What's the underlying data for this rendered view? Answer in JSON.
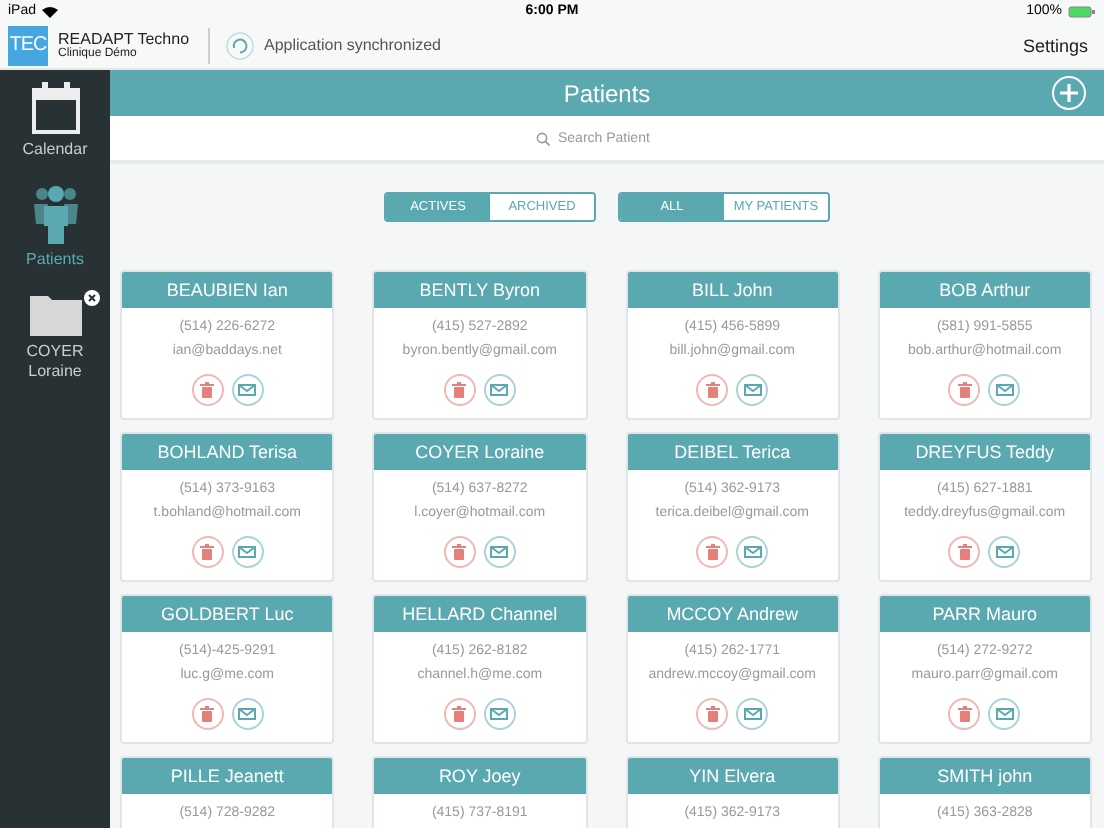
{
  "status_bar": {
    "device": "iPad",
    "time": "6:00 PM",
    "battery": "100%"
  },
  "header": {
    "logo": "TEC",
    "app_name": "READAPT Techno",
    "clinic": "Clinique Démo",
    "sync_status": "Application synchronized",
    "settings": "Settings"
  },
  "sidebar": {
    "items": [
      {
        "kind": "calendar",
        "label": "Calendar",
        "selected": false
      },
      {
        "kind": "patients",
        "label": "Patients",
        "selected": true
      },
      {
        "kind": "folder",
        "label": "COYER Loraine",
        "selected": false
      }
    ]
  },
  "title": "Patients",
  "search": {
    "placeholder": "Search Patient"
  },
  "filters": [
    [
      {
        "label": "ACTIVES",
        "selected": true
      },
      {
        "label": "ARCHIVED",
        "selected": false
      }
    ],
    [
      {
        "label": "ALL",
        "selected": true
      },
      {
        "label": "MY PATIENTS",
        "selected": false
      }
    ]
  ],
  "patients": [
    {
      "name": "BEAUBIEN Ian",
      "phone": "(514) 226-6272",
      "email": "ian@baddays.net"
    },
    {
      "name": "BENTLY Byron",
      "phone": "(415) 527-2892",
      "email": "byron.bently@gmail.com"
    },
    {
      "name": "BILL John",
      "phone": "(415) 456-5899",
      "email": "bill.john@gmail.com"
    },
    {
      "name": "BOB Arthur",
      "phone": "(581) 991-5855",
      "email": "bob.arthur@hotmail.com"
    },
    {
      "name": "BOHLAND Terisa",
      "phone": "(514) 373-9163",
      "email": "t.bohland@hotmail.com"
    },
    {
      "name": "COYER Loraine",
      "phone": "(514) 637-8272",
      "email": "l.coyer@hotmail.com"
    },
    {
      "name": "DEIBEL Terica",
      "phone": "(514) 362-9173",
      "email": "terica.deibel@gmail.com"
    },
    {
      "name": "DREYFUS Teddy",
      "phone": "(415) 627-1881",
      "email": "teddy.dreyfus@gmail.com"
    },
    {
      "name": "GOLDBERT Luc",
      "phone": "(514)-425-9291",
      "email": "luc.g@me.com"
    },
    {
      "name": "HELLARD Channel",
      "phone": "(415) 262-8182",
      "email": "channel.h@me.com"
    },
    {
      "name": "MCCOY Andrew",
      "phone": "(415) 262-1771",
      "email": "andrew.mccoy@gmail.com"
    },
    {
      "name": "PARR Mauro",
      "phone": "(514) 272-9272",
      "email": "mauro.parr@gmail.com"
    },
    {
      "name": "PILLE Jeanett",
      "phone": "(514) 728-9282"
    },
    {
      "name": "ROY Joey",
      "phone": "(415) 737-8191"
    },
    {
      "name": "YIN Elvera",
      "phone": "(415) 362-9173"
    },
    {
      "name": "SMITH john",
      "phone": "(415) 363-2828"
    }
  ]
}
